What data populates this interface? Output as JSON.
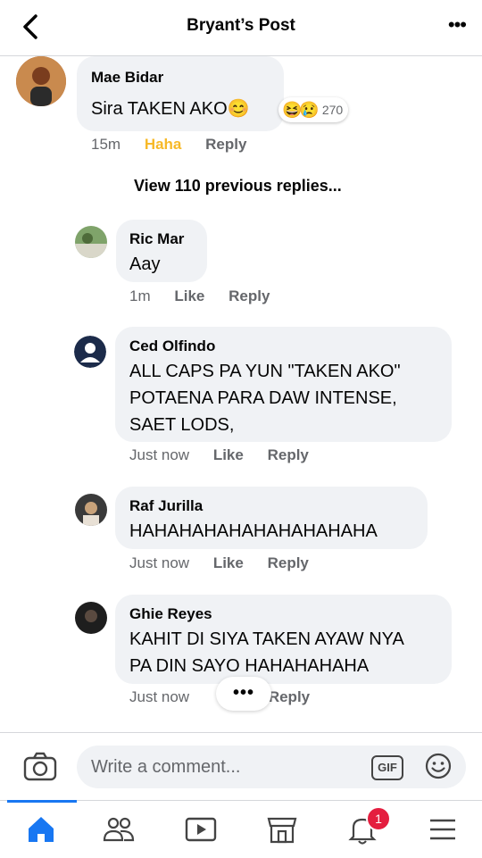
{
  "header": {
    "title": "Bryant’s Post"
  },
  "comment": {
    "author": "Mae Bidar",
    "text": "Sira TAKEN AKO😊",
    "reactions": {
      "emojis": [
        "😆",
        "😢"
      ],
      "count": "270"
    },
    "time": "15m",
    "reaction_label": "Haha",
    "reply_label": "Reply"
  },
  "view_previous": "View 110 previous replies...",
  "replies": [
    {
      "author": "Ric Mar",
      "lines": [
        "Aay"
      ],
      "time": "1m",
      "like": "Like",
      "reply": "Reply"
    },
    {
      "author": "Ced Olfindo",
      "lines": [
        "ALL CAPS PA YUN \"TAKEN AKO\"",
        "POTAENA PARA DAW INTENSE,",
        "SAET LODS,"
      ],
      "time": "Just now",
      "like": "Like",
      "reply": "Reply"
    },
    {
      "author": "Raf Jurilla",
      "lines": [
        "HAHAHAHAHAHAHAHAHAHA"
      ],
      "time": "Just now",
      "like": "Like",
      "reply": "Reply"
    },
    {
      "author": "Ghie Reyes",
      "lines": [
        "KAHIT DI SIYA TAKEN AYAW NYA",
        "PA DIN SAYO HAHAHAHAHA"
      ],
      "time": "Just now",
      "reply": "Reply"
    }
  ],
  "typing_indicator": "•••",
  "composer": {
    "placeholder": "Write a comment...",
    "gif_label": "GIF"
  },
  "tabbar": {
    "notification_count": "1",
    "icons": [
      "home-icon",
      "friends-icon",
      "watch-icon",
      "marketplace-icon",
      "bell-icon",
      "menu-icon"
    ]
  },
  "colors": {
    "accent": "#1877f2",
    "haha": "#f7b928",
    "badge": "#e41e3f",
    "bubble": "#f0f2f5"
  }
}
